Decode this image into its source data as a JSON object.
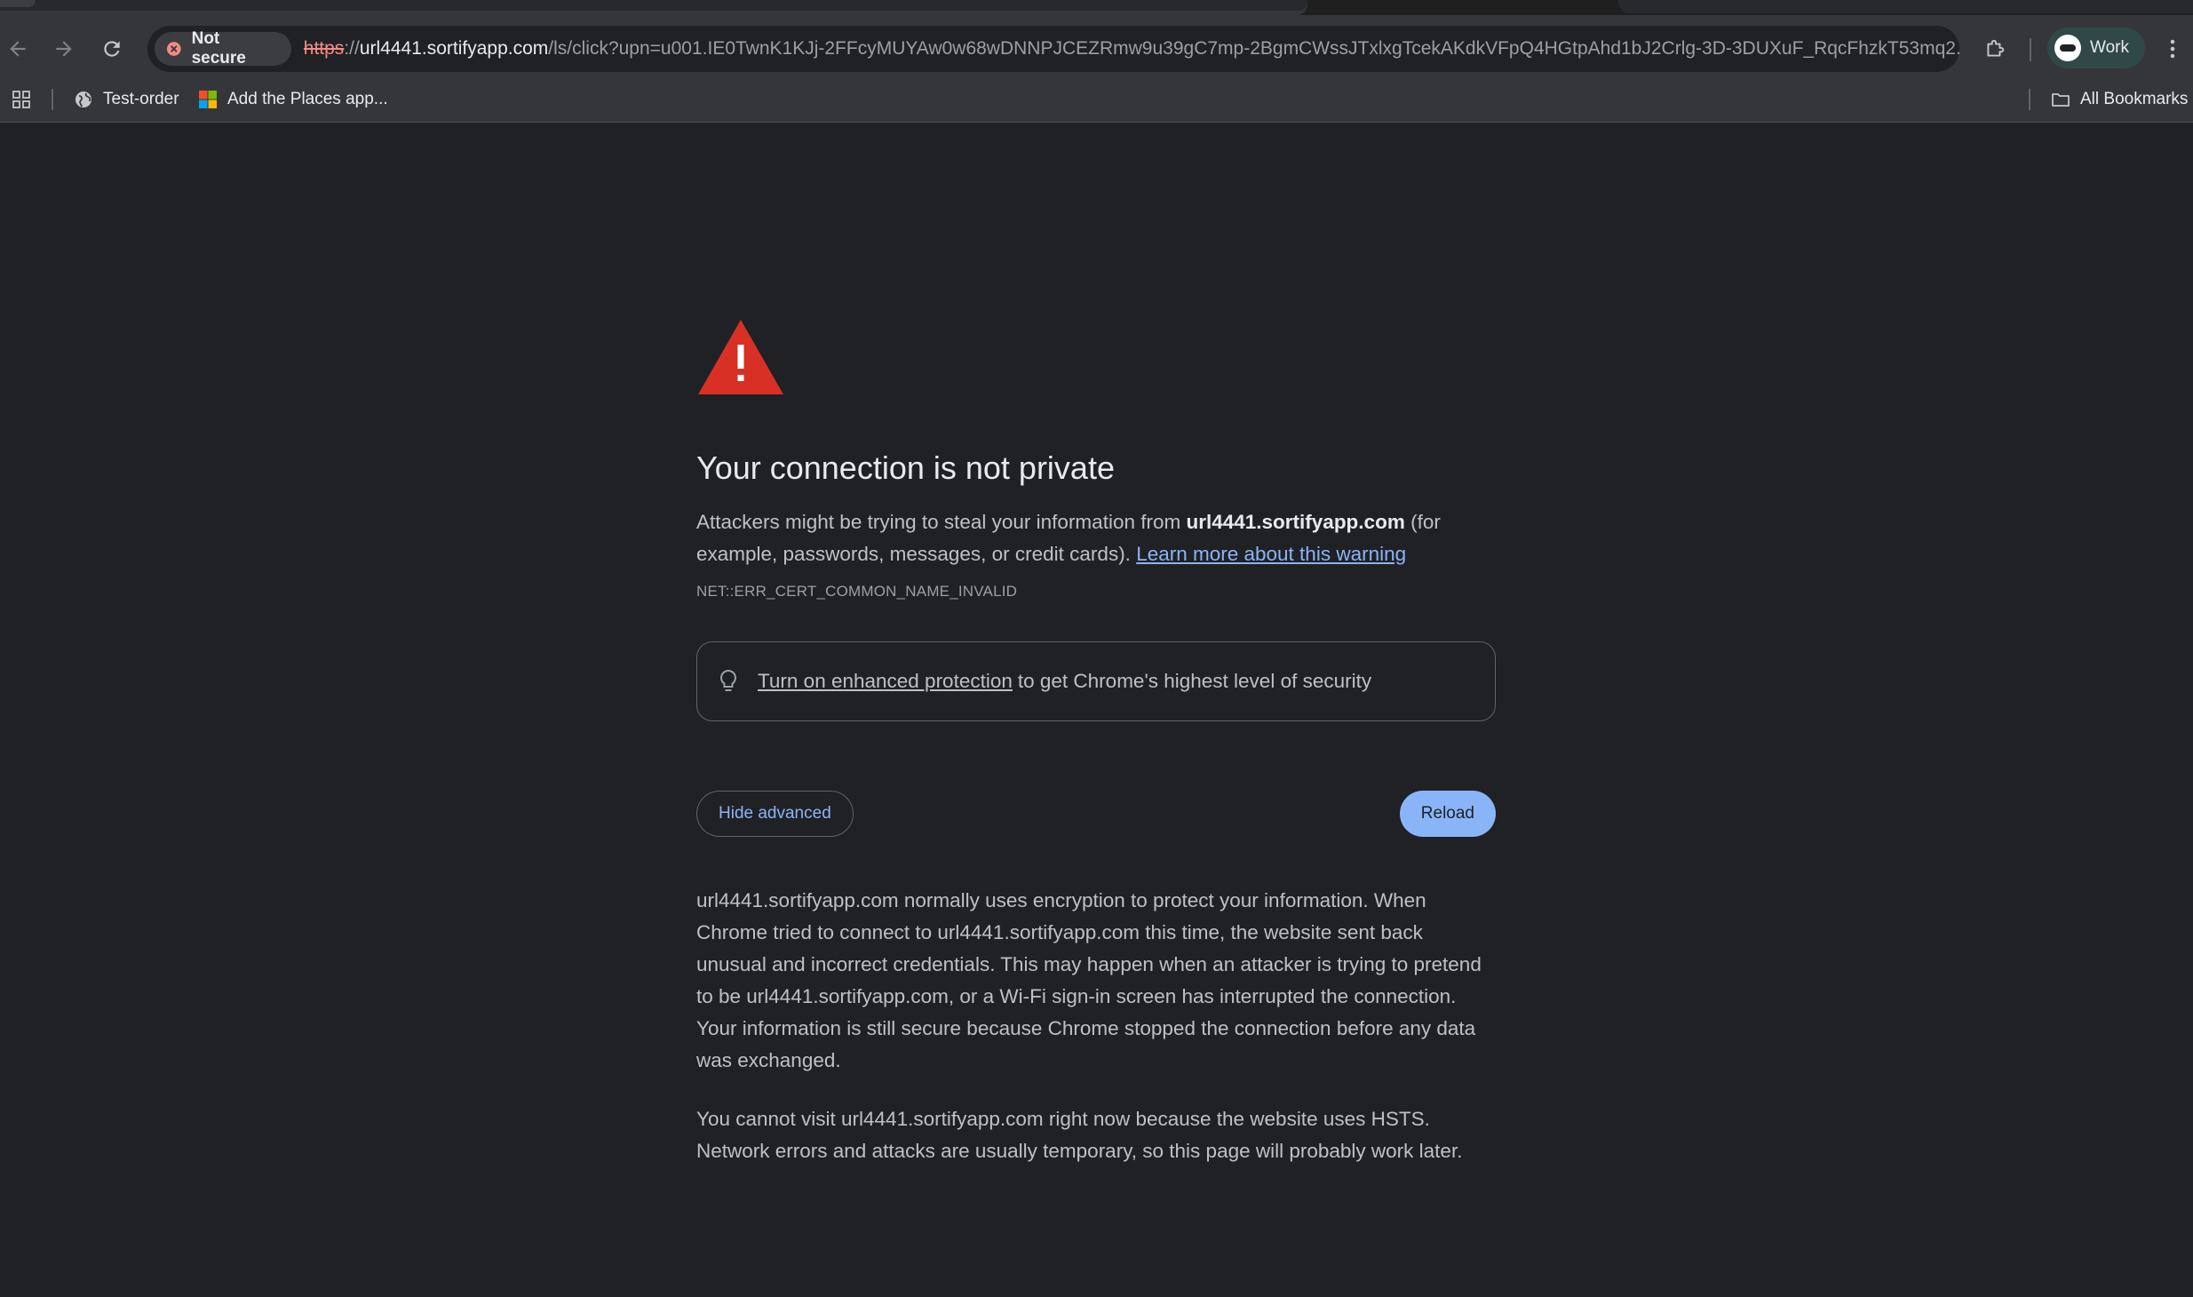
{
  "browser": {
    "security_label": "Not secure",
    "url_scheme": "https",
    "url_host_sep": "://",
    "url_host": "url4441.sortifyapp.com",
    "url_path": "/ls/click?upn=u001.IE0TwnK1KJj-2FFcyMUYAw0w68wDNNPJCEZRmw9u39gC7mp-2BgmCWssJTxlxgTcekAKdkVFpQ4HGtpAhd1bJ2Crlg-3D-3DUXuF_RqcFhzkT53mq2...",
    "profile_label": "Work",
    "bookmarks": [
      {
        "label": "Test-order",
        "icon": "globe-icon"
      },
      {
        "label": "Add the Places app...",
        "icon": "microsoft-icon"
      }
    ],
    "all_bookmarks_label": "All Bookmarks",
    "colors": {
      "not_secure_red": "#f28b82",
      "link_blue": "#8ab4f8",
      "warning_red": "#d93025",
      "profile_chip": "#304848"
    }
  },
  "interstitial": {
    "heading": "Your connection is not private",
    "desc_prefix": "Attackers might be trying to steal your information from ",
    "desc_host": "url4441.sortifyapp.com",
    "desc_suffix": " (for example, passwords, messages, or credit cards). ",
    "learn_more": "Learn more about this warning",
    "error_code": "NET::ERR_CERT_COMMON_NAME_INVALID",
    "protection_link": "Turn on enhanced protection",
    "protection_text": "to get Chrome's highest level of security",
    "hide_advanced_label": "Hide advanced",
    "reload_label": "Reload",
    "details_p1": "url4441.sortifyapp.com normally uses encryption to protect your information. When Chrome tried to connect to url4441.sortifyapp.com this time, the website sent back unusual and incorrect credentials. This may happen when an attacker is trying to pretend to be url4441.sortifyapp.com, or a Wi-Fi sign-in screen has interrupted the connection. Your information is still secure because Chrome stopped the connection before any data was exchanged.",
    "details_p2": "You cannot visit url4441.sortifyapp.com right now because the website uses HSTS. Network errors and attacks are usually temporary, so this page will probably work later."
  }
}
